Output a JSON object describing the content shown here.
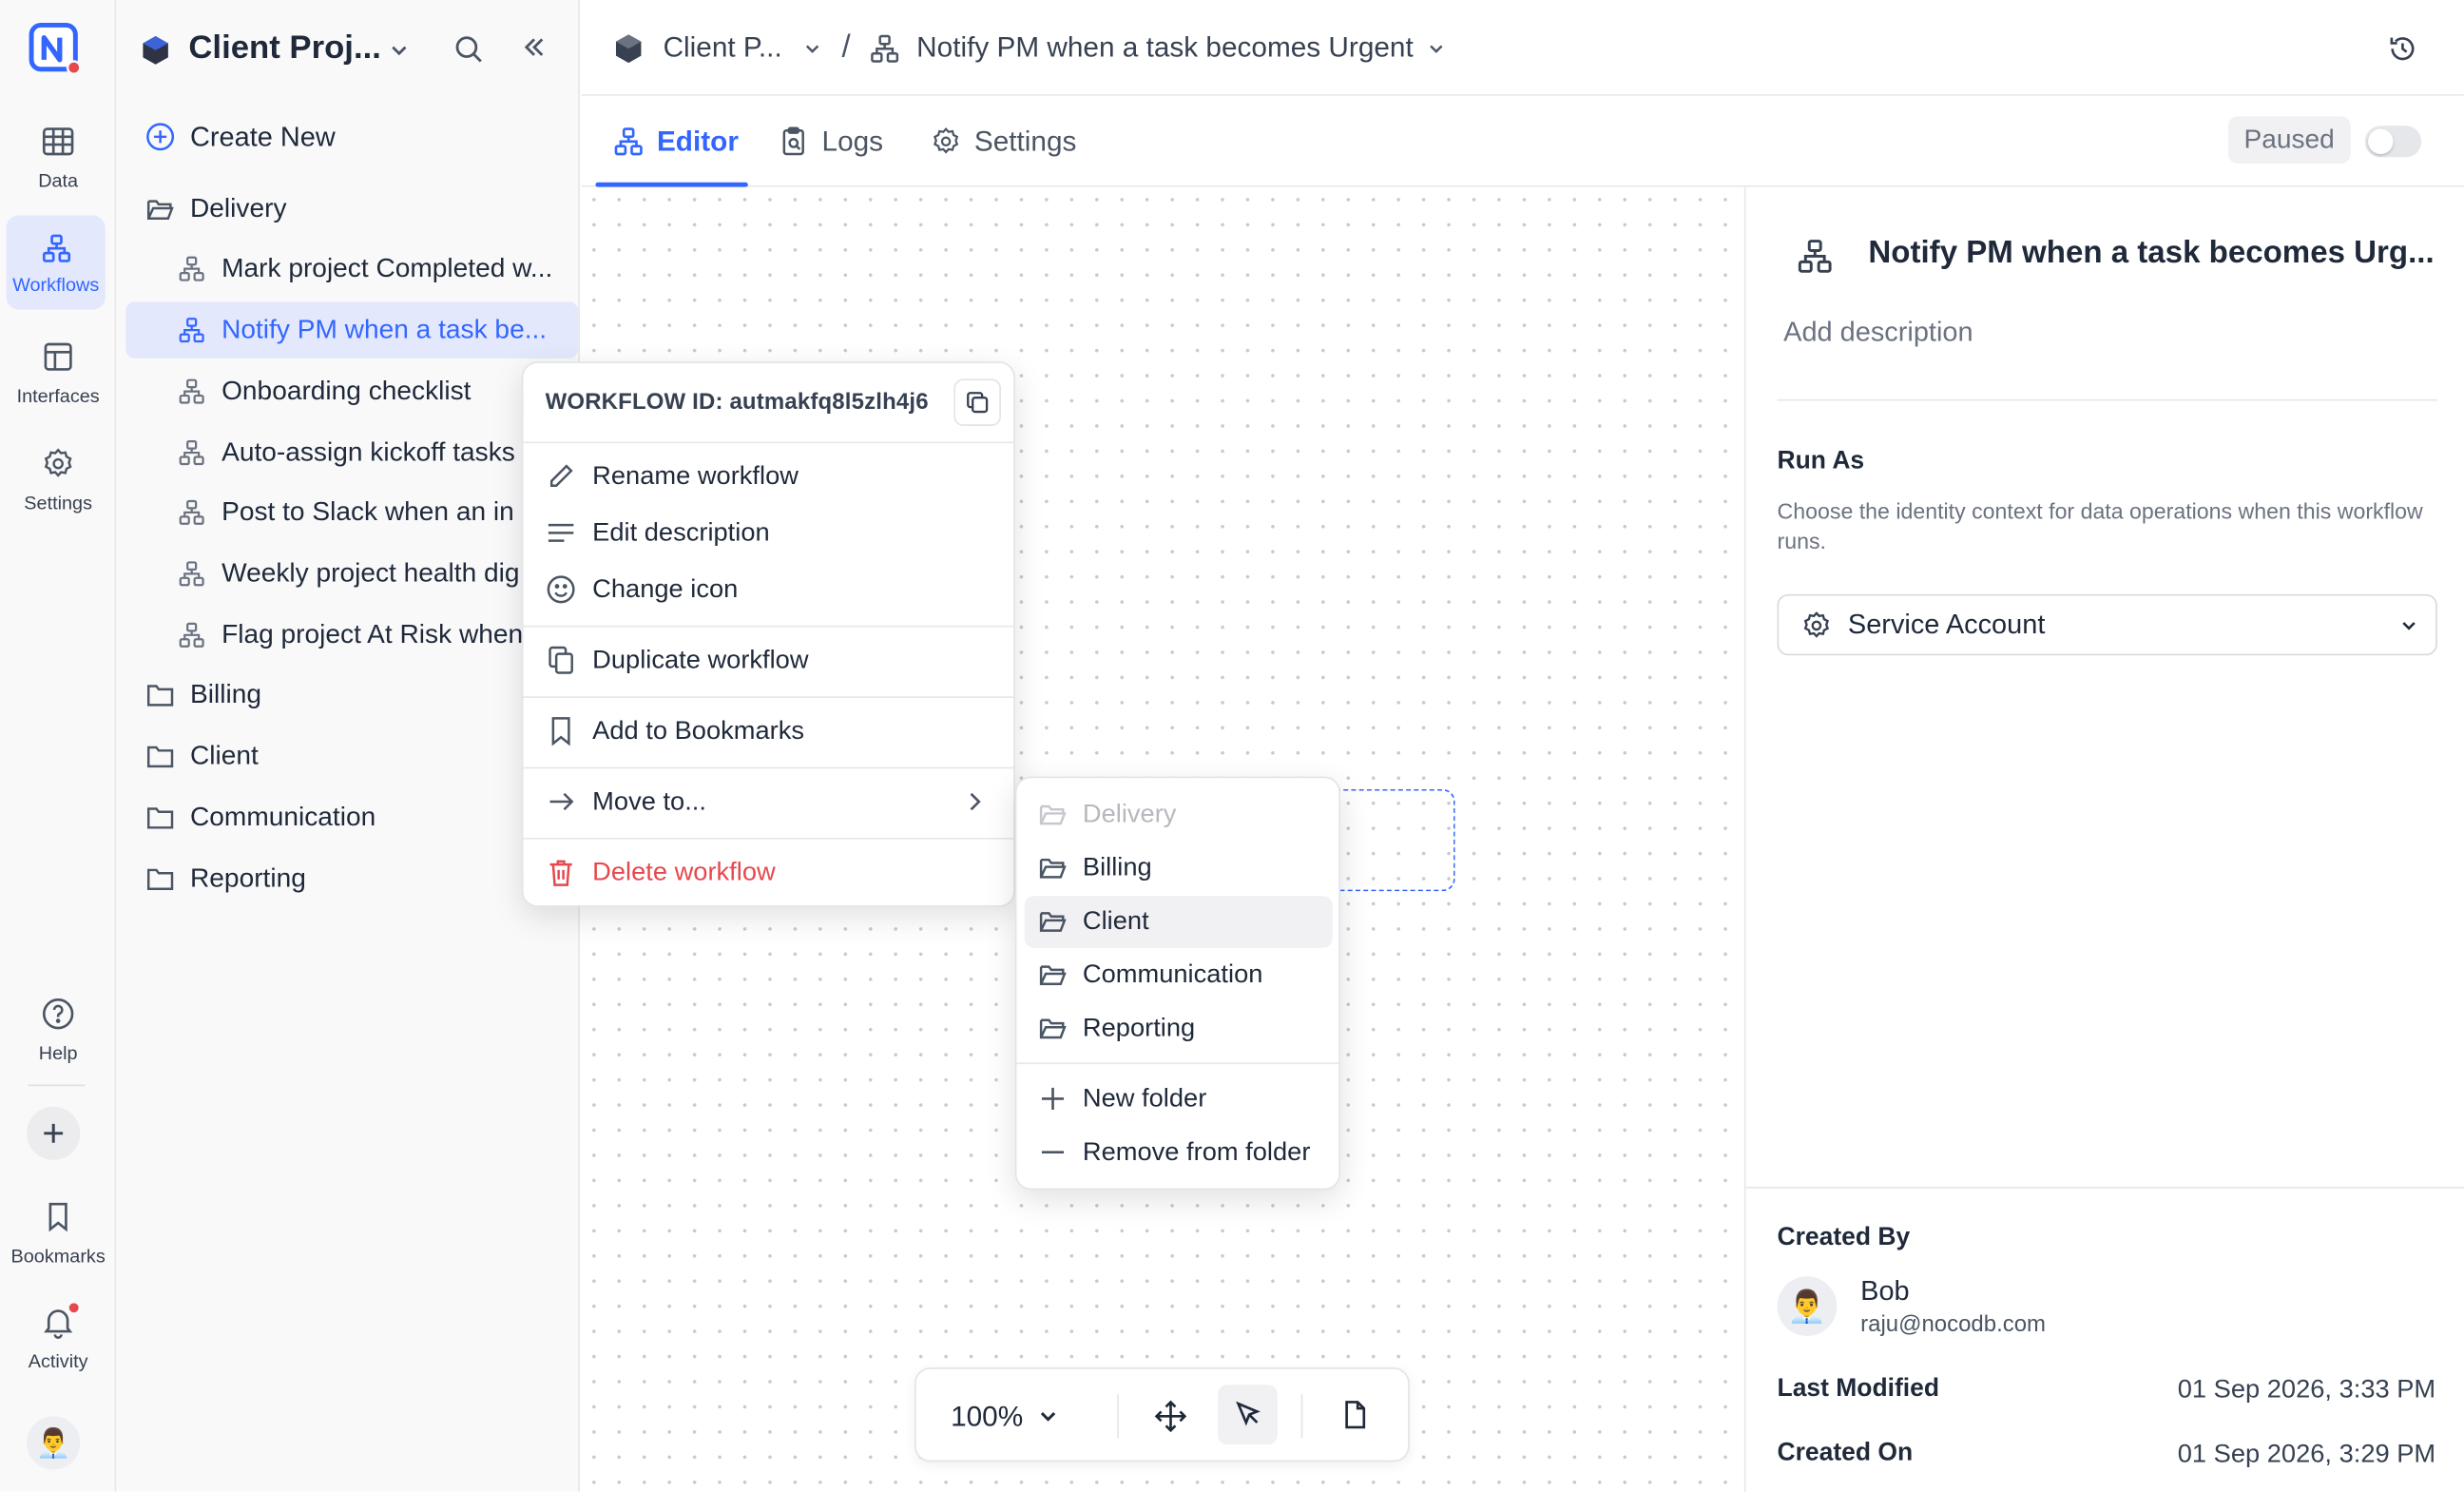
{
  "rail": {
    "items": [
      {
        "label": "Data"
      },
      {
        "label": "Workflows"
      },
      {
        "label": "Interfaces"
      },
      {
        "label": "Settings"
      }
    ],
    "bottom": [
      {
        "label": "Help"
      },
      {
        "label": "Bookmarks"
      },
      {
        "label": "Activity"
      }
    ]
  },
  "sidebar": {
    "base_title": "Client Proj...",
    "create_new": "Create New",
    "folders": [
      {
        "name": "Delivery",
        "workflows": [
          "Mark project Completed w...",
          "Notify PM when a task be...",
          "Onboarding checklist",
          "Auto-assign kickoff tasks",
          "Post to Slack when an in",
          "Weekly project health dig",
          "Flag project At Risk when"
        ]
      },
      {
        "name": "Billing"
      },
      {
        "name": "Client"
      },
      {
        "name": "Communication"
      },
      {
        "name": "Reporting"
      }
    ]
  },
  "header": {
    "breadcrumb_base": "Client P...",
    "separator": "/",
    "workflow_title": "Notify PM when a task becomes Urgent"
  },
  "tabs": [
    {
      "label": "Editor"
    },
    {
      "label": "Logs"
    },
    {
      "label": "Settings"
    }
  ],
  "status": {
    "label": "Paused",
    "enabled": false
  },
  "context_menu": {
    "workflow_id": "WORKFLOW ID: autmakfq8l5zlh4j6",
    "items": [
      {
        "label": "Rename workflow"
      },
      {
        "label": "Edit description"
      },
      {
        "label": "Change icon"
      },
      {
        "label": "Duplicate workflow"
      },
      {
        "label": "Add to Bookmarks"
      },
      {
        "label": "Move to..."
      },
      {
        "label": "Delete workflow"
      }
    ]
  },
  "submenu": {
    "folders": [
      "Delivery",
      "Billing",
      "Client",
      "Communication",
      "Reporting"
    ],
    "new_folder": "New folder",
    "remove": "Remove from folder"
  },
  "toolbar": {
    "zoom": "100%"
  },
  "panel": {
    "title": "Notify PM when a task becomes Urg...",
    "description_placeholder": "Add description",
    "run_as_heading": "Run As",
    "run_as_help": "Choose the identity context for data operations when this workflow runs.",
    "run_as_value": "Service Account",
    "created_by_label": "Created By",
    "user_name": "Bob",
    "user_email": "raju@nocodb.com",
    "last_modified_label": "Last Modified",
    "last_modified": "01 Sep 2026, 3:33 PM",
    "created_on_label": "Created On",
    "created_on": "01 Sep 2026, 3:29 PM"
  },
  "colors": {
    "accent": "#3366ff",
    "danger": "#e5484d",
    "logo": "#3366ff"
  }
}
